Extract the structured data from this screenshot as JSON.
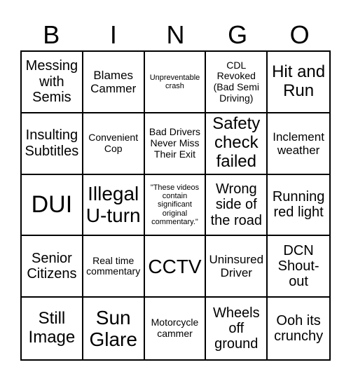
{
  "header": {
    "letters": [
      "B",
      "I",
      "N",
      "G",
      "O"
    ]
  },
  "cells": [
    [
      "Messing with Semis",
      "Blames Cammer",
      "Unpreventable crash",
      "CDL Revoked (Bad Semi Driving)",
      "Hit and Run"
    ],
    [
      "Insulting Subtitles",
      "Convenient Cop",
      "Bad Drivers Never Miss Their Exit",
      "Safety check failed",
      "Inclement weather"
    ],
    [
      "DUI",
      "Illegal U-turn",
      "\"These videos contain significant original commentary.\"",
      "Wrong side of the road",
      "Running red light"
    ],
    [
      "Senior Citizens",
      "Real time commentary",
      "CCTV",
      "Uninsured Driver",
      "DCN Shout-out"
    ],
    [
      "Still Image",
      "Sun Glare",
      "Motorcycle cammer",
      "Wheels off ground",
      "Ooh its crunchy"
    ]
  ]
}
